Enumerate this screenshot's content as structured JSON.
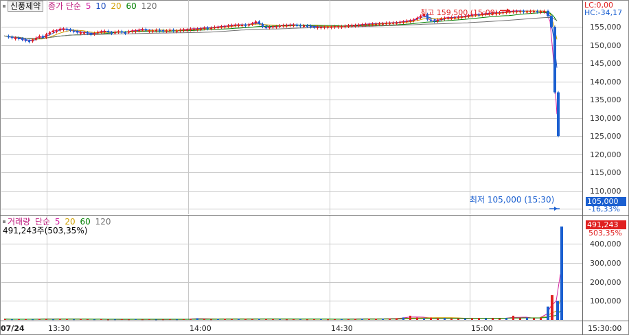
{
  "stock_name": "신풍제약",
  "price_legend": {
    "label": "종가 단순",
    "periods": [
      "5",
      "10",
      "20",
      "60",
      "120"
    ],
    "colors": [
      "#d020a0",
      "#2050c0",
      "#d0a000",
      "#008000",
      "#707070"
    ]
  },
  "volume_legend": {
    "label": "거래량",
    "ma_label": "단순",
    "periods": [
      "5",
      "20",
      "60",
      "120"
    ],
    "colors": [
      "#d020a0",
      "#d0a000",
      "#008000",
      "#707070"
    ],
    "value_text": "491,243주(503,35%)"
  },
  "indicators": {
    "lc": "LC:0,00",
    "hc": "HC:-34,17"
  },
  "annotations": {
    "high": "최고 159,500 (15:09)",
    "low": "최저 105,000 (15:30)"
  },
  "current_price": {
    "price": "105,000",
    "change": "-16,33%"
  },
  "current_volume": {
    "volume": "491,243",
    "ratio": "503,35%"
  },
  "date_label": "07/24",
  "colors": {
    "up": "#e02020",
    "down": "#1a5fd0",
    "grid": "#c8c8c8"
  },
  "chart_data": [
    {
      "type": "candlestick",
      "price_axis": {
        "ticks": [
          "155,000",
          "150,000",
          "145,000",
          "140,000",
          "135,000",
          "130,000",
          "125,000",
          "120,000",
          "115,000",
          "110,000",
          "105,000"
        ],
        "ylim": [
          103500,
          160500
        ]
      },
      "time_axis": {
        "ticks": [
          "13:30",
          "14:00",
          "14:30",
          "15:00",
          "15:30:00"
        ]
      },
      "close_series": [
        [
          0,
          152500
        ],
        [
          5,
          152300
        ],
        [
          10,
          152000
        ],
        [
          15,
          152000
        ],
        [
          20,
          151800
        ],
        [
          25,
          151500
        ],
        [
          30,
          151200
        ],
        [
          35,
          151000
        ],
        [
          40,
          151500
        ],
        [
          45,
          152000
        ],
        [
          50,
          152500
        ],
        [
          55,
          152000
        ],
        [
          60,
          153000
        ],
        [
          65,
          153500
        ],
        [
          70,
          154000
        ],
        [
          75,
          154000
        ],
        [
          80,
          154500
        ],
        [
          85,
          154500
        ],
        [
          90,
          154300
        ],
        [
          95,
          154000
        ],
        [
          100,
          153800
        ],
        [
          105,
          153500
        ],
        [
          110,
          153500
        ],
        [
          115,
          153500
        ],
        [
          120,
          153200
        ],
        [
          125,
          153000
        ],
        [
          130,
          153300
        ],
        [
          135,
          153600
        ],
        [
          140,
          153800
        ],
        [
          145,
          153900
        ],
        [
          150,
          153500
        ],
        [
          155,
          153400
        ],
        [
          160,
          153600
        ],
        [
          165,
          153800
        ],
        [
          170,
          153500
        ],
        [
          175,
          153400
        ],
        [
          180,
          153800
        ],
        [
          185,
          154000
        ],
        [
          190,
          154000
        ],
        [
          195,
          154200
        ],
        [
          200,
          154400
        ],
        [
          205,
          154000
        ],
        [
          210,
          154000
        ],
        [
          215,
          154000
        ],
        [
          220,
          154200
        ],
        [
          225,
          154100
        ],
        [
          230,
          154000
        ],
        [
          235,
          154000
        ],
        [
          240,
          154200
        ],
        [
          245,
          154000
        ],
        [
          250,
          154000
        ],
        [
          255,
          154200
        ],
        [
          260,
          154300
        ],
        [
          265,
          154300
        ],
        [
          270,
          154500
        ],
        [
          275,
          154500
        ],
        [
          280,
          154500
        ],
        [
          285,
          154600
        ],
        [
          290,
          154800
        ],
        [
          295,
          154700
        ],
        [
          300,
          154800
        ],
        [
          305,
          155000
        ],
        [
          310,
          155000
        ],
        [
          315,
          155200
        ],
        [
          320,
          155200
        ],
        [
          325,
          155400
        ],
        [
          330,
          155500
        ],
        [
          335,
          155600
        ],
        [
          340,
          155600
        ],
        [
          345,
          155600
        ],
        [
          350,
          155500
        ],
        [
          355,
          155700
        ],
        [
          360,
          156000
        ],
        [
          365,
          156500
        ],
        [
          370,
          155800
        ],
        [
          375,
          155000
        ],
        [
          380,
          154800
        ],
        [
          385,
          155000
        ],
        [
          390,
          155200
        ],
        [
          395,
          155200
        ],
        [
          400,
          155400
        ],
        [
          405,
          155500
        ],
        [
          410,
          155500
        ],
        [
          415,
          155600
        ],
        [
          420,
          155600
        ],
        [
          425,
          155500
        ],
        [
          430,
          155400
        ],
        [
          435,
          155400
        ],
        [
          440,
          155300
        ],
        [
          445,
          155200
        ],
        [
          450,
          155000
        ],
        [
          455,
          155000
        ],
        [
          460,
          155000
        ],
        [
          465,
          155100
        ],
        [
          470,
          155100
        ],
        [
          475,
          155100
        ],
        [
          480,
          155200
        ],
        [
          485,
          155200
        ],
        [
          490,
          155200
        ],
        [
          495,
          155300
        ],
        [
          500,
          155400
        ],
        [
          505,
          155500
        ],
        [
          510,
          155500
        ],
        [
          515,
          155600
        ],
        [
          520,
          155700
        ],
        [
          525,
          155800
        ],
        [
          530,
          155800
        ],
        [
          535,
          155900
        ],
        [
          540,
          155900
        ],
        [
          545,
          156000
        ],
        [
          550,
          156000
        ],
        [
          555,
          156100
        ],
        [
          560,
          156100
        ],
        [
          565,
          156200
        ],
        [
          570,
          156200
        ],
        [
          575,
          156400
        ],
        [
          580,
          156500
        ],
        [
          585,
          156700
        ],
        [
          590,
          156800
        ],
        [
          595,
          157000
        ],
        [
          600,
          157500
        ],
        [
          605,
          158000
        ],
        [
          610,
          158500
        ],
        [
          615,
          157000
        ],
        [
          620,
          156800
        ],
        [
          625,
          156500
        ],
        [
          630,
          157000
        ],
        [
          635,
          157300
        ],
        [
          640,
          157500
        ],
        [
          645,
          157600
        ],
        [
          650,
          157600
        ],
        [
          655,
          157700
        ],
        [
          660,
          157800
        ],
        [
          665,
          157900
        ],
        [
          670,
          158000
        ],
        [
          675,
          158200
        ],
        [
          680,
          158300
        ],
        [
          685,
          158500
        ],
        [
          690,
          158400
        ],
        [
          695,
          158600
        ],
        [
          700,
          158700
        ],
        [
          705,
          158800
        ],
        [
          710,
          158900
        ],
        [
          715,
          158900
        ],
        [
          720,
          159000
        ],
        [
          725,
          159100
        ],
        [
          730,
          159200
        ],
        [
          735,
          159300
        ],
        [
          740,
          159400
        ],
        [
          745,
          159400
        ],
        [
          750,
          159400
        ],
        [
          755,
          159300
        ],
        [
          760,
          159300
        ],
        [
          765,
          159400
        ],
        [
          770,
          159400
        ],
        [
          775,
          159300
        ],
        [
          780,
          159300
        ],
        [
          785,
          159400
        ],
        [
          790,
          158000
        ],
        [
          795,
          155000
        ],
        [
          800,
          137000
        ],
        [
          805,
          125000
        ]
      ],
      "volume_axis": {
        "ticks": [
          "400,000",
          "300,000",
          "200,000",
          "100,000"
        ],
        "ylim": [
          0,
          520000
        ]
      },
      "volume_series": [
        [
          0,
          4000
        ],
        [
          10,
          3000
        ],
        [
          20,
          3500
        ],
        [
          30,
          4000
        ],
        [
          40,
          3000
        ],
        [
          50,
          5000
        ],
        [
          60,
          4500
        ],
        [
          70,
          3000
        ],
        [
          80,
          5000
        ],
        [
          90,
          4000
        ],
        [
          100,
          3000
        ],
        [
          110,
          4500
        ],
        [
          120,
          3500
        ],
        [
          130,
          3000
        ],
        [
          140,
          4000
        ],
        [
          150,
          2500
        ],
        [
          160,
          3000
        ],
        [
          170,
          3500
        ],
        [
          180,
          3000
        ],
        [
          190,
          4000
        ],
        [
          200,
          3000
        ],
        [
          210,
          3500
        ],
        [
          220,
          2500
        ],
        [
          230,
          3000
        ],
        [
          240,
          3500
        ],
        [
          250,
          3000
        ],
        [
          260,
          4000
        ],
        [
          270,
          5000
        ],
        [
          280,
          9000
        ],
        [
          290,
          4000
        ],
        [
          300,
          3000
        ],
        [
          310,
          4500
        ],
        [
          320,
          5000
        ],
        [
          330,
          4000
        ],
        [
          340,
          6000
        ],
        [
          350,
          5000
        ],
        [
          360,
          4000
        ],
        [
          370,
          5000
        ],
        [
          380,
          4000
        ],
        [
          390,
          3500
        ],
        [
          400,
          4000
        ],
        [
          410,
          3000
        ],
        [
          420,
          3500
        ],
        [
          430,
          4000
        ],
        [
          440,
          3000
        ],
        [
          450,
          3500
        ],
        [
          460,
          4000
        ],
        [
          470,
          3000
        ],
        [
          480,
          3500
        ],
        [
          490,
          4000
        ],
        [
          500,
          4000
        ],
        [
          510,
          5000
        ],
        [
          520,
          6000
        ],
        [
          530,
          5500
        ],
        [
          540,
          5000
        ],
        [
          550,
          6000
        ],
        [
          560,
          7000
        ],
        [
          570,
          9000
        ],
        [
          580,
          13000
        ],
        [
          590,
          22000
        ],
        [
          600,
          12000
        ],
        [
          610,
          9000
        ],
        [
          620,
          12000
        ],
        [
          630,
          8000
        ],
        [
          640,
          10000
        ],
        [
          650,
          7000
        ],
        [
          660,
          6000
        ],
        [
          670,
          7000
        ],
        [
          680,
          8000
        ],
        [
          690,
          9000
        ],
        [
          700,
          8000
        ],
        [
          710,
          9000
        ],
        [
          720,
          7000
        ],
        [
          730,
          10000
        ],
        [
          740,
          22000
        ],
        [
          750,
          9000
        ],
        [
          760,
          12000
        ],
        [
          770,
          9000
        ],
        [
          780,
          11000
        ],
        [
          790,
          70000
        ],
        [
          796,
          130000
        ],
        [
          804,
          100000
        ],
        [
          810,
          491243
        ]
      ]
    }
  ]
}
